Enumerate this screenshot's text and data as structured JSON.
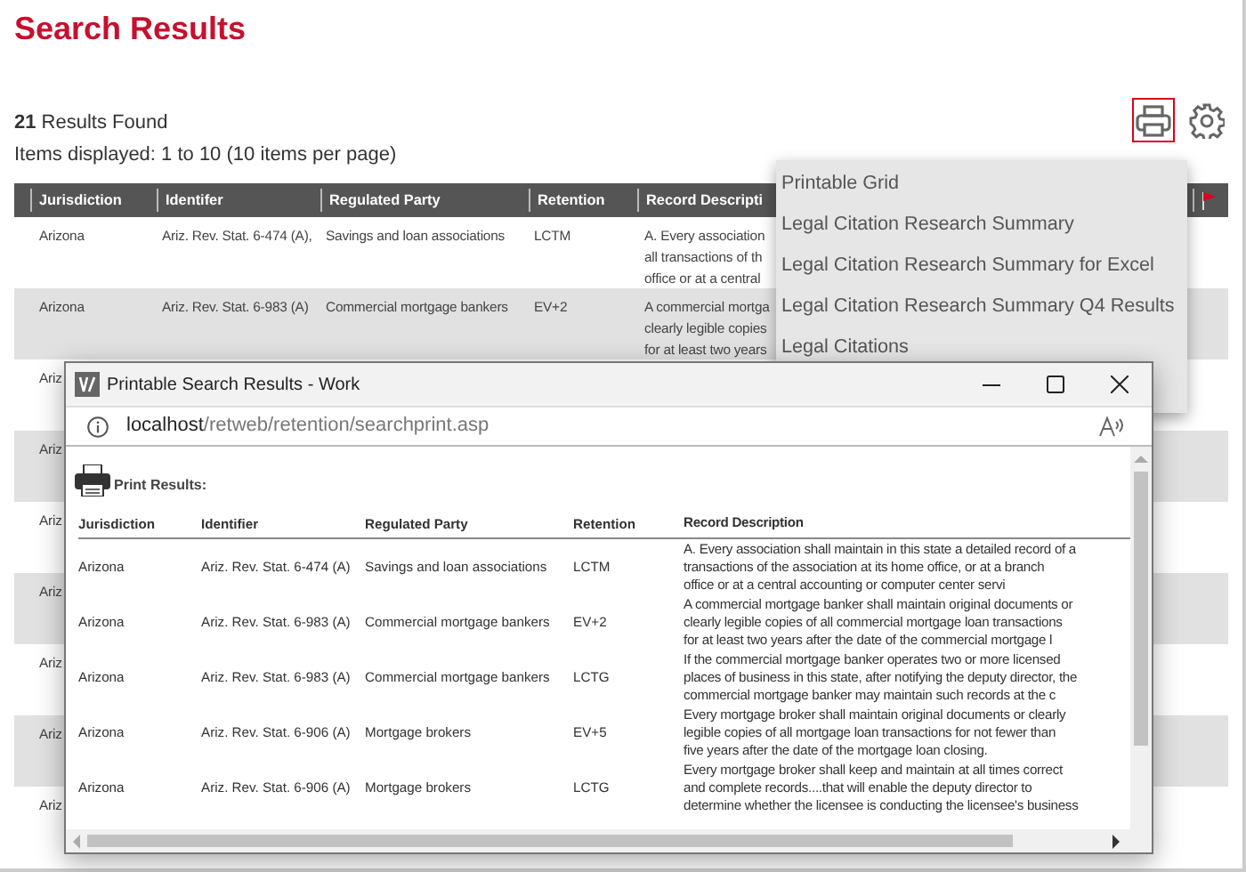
{
  "page": {
    "title": "Search Results",
    "results_found": "**21** Results Found",
    "items_displayed": "Items displayed: 1 to 10 (10 items per page)"
  },
  "toolbar": [
    {
      "kind": "print",
      "selected": true
    },
    {
      "kind": "settings",
      "selected": false
    }
  ],
  "grid": {
    "columns": [
      "Jurisdiction",
      "Identifer",
      "Regulated Party",
      "Retention",
      "Record Descripti"
    ],
    "rows": [
      {
        "jurisdiction": "Arizona",
        "identifier": "Ariz. Rev. Stat. 6-474 (A),",
        "regulated_party": "Savings and loan associations",
        "retention": "LCTM",
        "record_description": [
          "A. Every association",
          "all transactions of th",
          "office or at a central"
        ]
      },
      {
        "jurisdiction": "Arizona",
        "identifier": "Ariz. Rev. Stat. 6-983 (A)",
        "regulated_party": "Commercial mortgage bankers",
        "retention": "EV+2",
        "record_description": [
          "A commercial mortga",
          "clearly legible copies",
          "for at least two years"
        ]
      },
      {
        "jurisdiction": "Ariz"
      },
      {
        "jurisdiction": "Ariz"
      },
      {
        "jurisdiction": "Ariz"
      },
      {
        "jurisdiction": "Ariz"
      },
      {
        "jurisdiction": "Ariz"
      },
      {
        "jurisdiction": "Ariz"
      },
      {
        "jurisdiction": "Ariz"
      }
    ]
  },
  "print_menu": {
    "items": [
      "Printable Grid",
      "Legal Citation Research Summary",
      "Legal Citation Research Summary for Excel",
      "Legal Citation Research Summary Q4 Results",
      "Legal Citations"
    ]
  },
  "popup": {
    "title": "Printable Search Results - Work",
    "address_host": "localhost",
    "address_path": "/retweb/retention/searchprint.asp",
    "heading": "Print Results:",
    "columns": [
      "Jurisdiction",
      "Identifier",
      "Regulated Party",
      "Retention",
      "Record Description"
    ],
    "rows": [
      {
        "jurisdiction": "Arizona",
        "identifier": "Ariz. Rev. Stat. 6-474 (A)",
        "regulated_party": "Savings and loan associations",
        "retention": "LCTM",
        "record_description": [
          "A. Every association shall maintain in this state a detailed record of a",
          "transactions of the association at its home office, or at a branch",
          "office or at a central accounting or computer center servi"
        ]
      },
      {
        "jurisdiction": "Arizona",
        "identifier": "Ariz. Rev. Stat. 6-983 (A)",
        "regulated_party": "Commercial mortgage bankers",
        "retention": "EV+2",
        "record_description": [
          "A commercial mortgage banker shall maintain original documents or",
          "clearly legible copies of all commercial mortgage loan transactions",
          "for at least two years after the date of the commercial mortgage l"
        ]
      },
      {
        "jurisdiction": "Arizona",
        "identifier": "Ariz. Rev. Stat. 6-983 (A)",
        "regulated_party": "Commercial mortgage bankers",
        "retention": "LCTG",
        "record_description": [
          "If the commercial mortgage banker operates two or more licensed",
          "places of business in this state, after notifying the deputy director, the",
          "commercial mortgage banker may maintain such records at the c"
        ]
      },
      {
        "jurisdiction": "Arizona",
        "identifier": "Ariz. Rev. Stat. 6-906 (A)",
        "regulated_party": "Mortgage brokers",
        "retention": "EV+5",
        "record_description": [
          "Every mortgage broker shall maintain original documents or clearly",
          "legible copies of all mortgage loan transactions for not fewer than",
          "five years after the date of the mortgage loan closing."
        ]
      },
      {
        "jurisdiction": "Arizona",
        "identifier": "Ariz. Rev. Stat. 6-906 (A)",
        "regulated_party": "Mortgage brokers",
        "retention": "LCTG",
        "record_description": [
          "Every mortgage broker shall keep and maintain at all times correct",
          "and complete records....that will enable the deputy director to",
          "determine whether the licensee is conducting the licensee's business"
        ]
      }
    ]
  }
}
